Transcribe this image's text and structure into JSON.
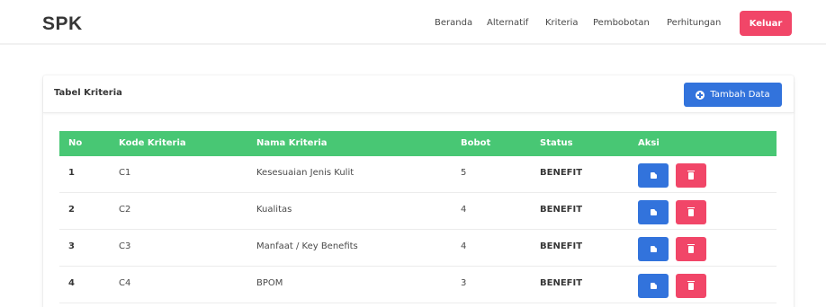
{
  "navbar": {
    "brand": "SPK",
    "links": [
      "Beranda",
      "Alternatif",
      "Kriteria",
      "Pembobotan",
      "Perhitungan"
    ],
    "logout_label": "Keluar",
    "colors": {
      "logout": "#f14668"
    }
  },
  "card": {
    "title": "Tabel Kriteria",
    "add_button_label": "Tambah Data",
    "add_button_icon": "plus-circle-icon"
  },
  "table": {
    "header_color": "#48c774",
    "columns": [
      "No",
      "Kode Kriteria",
      "Nama Kriteria",
      "Bobot",
      "Status",
      "Aksi"
    ],
    "rows": [
      {
        "no": "1",
        "kode": "C1",
        "nama": "Kesesuaian Jenis Kulit",
        "bobot": "5",
        "status": "BENEFIT"
      },
      {
        "no": "2",
        "kode": "C2",
        "nama": "Kualitas",
        "bobot": "4",
        "status": "BENEFIT"
      },
      {
        "no": "3",
        "kode": "C3",
        "nama": "Manfaat / Key Benefits",
        "bobot": "4",
        "status": "BENEFIT"
      },
      {
        "no": "4",
        "kode": "C4",
        "nama": "BPOM",
        "bobot": "3",
        "status": "BENEFIT"
      }
    ],
    "actions": {
      "edit_icon": "edit-icon",
      "delete_icon": "trash-icon",
      "edit_color": "#3273dc",
      "delete_color": "#f14668"
    }
  }
}
